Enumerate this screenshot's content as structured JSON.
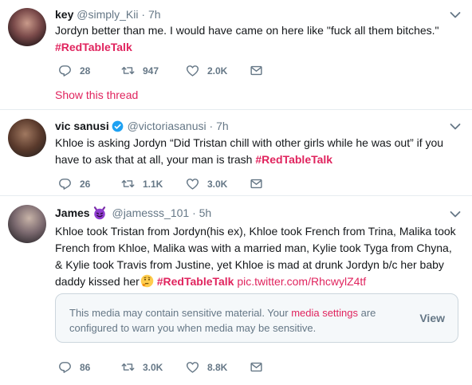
{
  "tweets": [
    {
      "name": "key",
      "handle": "@simply_Kii",
      "dot": " · ",
      "time": "7h",
      "text": "Jordyn better than me.  I would have came on here like \"fuck all them bitches.\"",
      "hashtag": "#RedTableTalk",
      "replies": "28",
      "retweets": "947",
      "likes": "2.0K",
      "show_thread": "Show this thread"
    },
    {
      "name": "vic sanusi",
      "handle": "@victoriasanusi",
      "dot": " · ",
      "time": "7h",
      "text": "Khloe is asking Jordyn “Did Tristan chill with other girls while he was out” if you have to ask that at all, your man is trash ",
      "hashtag": "#RedTableTalk",
      "replies": "26",
      "retweets": "1.1K",
      "likes": "3.0K"
    },
    {
      "name": "James",
      "handle": "@jamesss_101",
      "dot": " · ",
      "time": "5h",
      "text": "Khloe took Tristan from Jordyn(his ex), Khloe took French from Trina, Malika took French from Khloe, Malika was with a married man, Kylie took Tyga from Chyna, & Kylie took Travis from Justine, yet Khloe is mad at drunk Jordyn b/c her baby daddy kissed her",
      "hashtag": "#RedTableTalk",
      "link": "pic.twitter.com/RhcwylZ4tf",
      "replies": "86",
      "retweets": "3.0K",
      "likes": "8.8K",
      "notice": {
        "text_before": "This media may contain sensitive material. Your ",
        "link": "media settings",
        "text_after": " are configured to warn you when media may be sensitive.",
        "view": "View"
      }
    }
  ],
  "colors": {
    "accent": "#e0245e",
    "muted": "#657786",
    "verified": "#1da1f2"
  },
  "icons": [
    "reply-icon",
    "retweet-icon",
    "like-icon",
    "message-icon",
    "caret-down-icon",
    "verified-icon",
    "devil-emoji-icon",
    "thinking-emoji-icon"
  ]
}
